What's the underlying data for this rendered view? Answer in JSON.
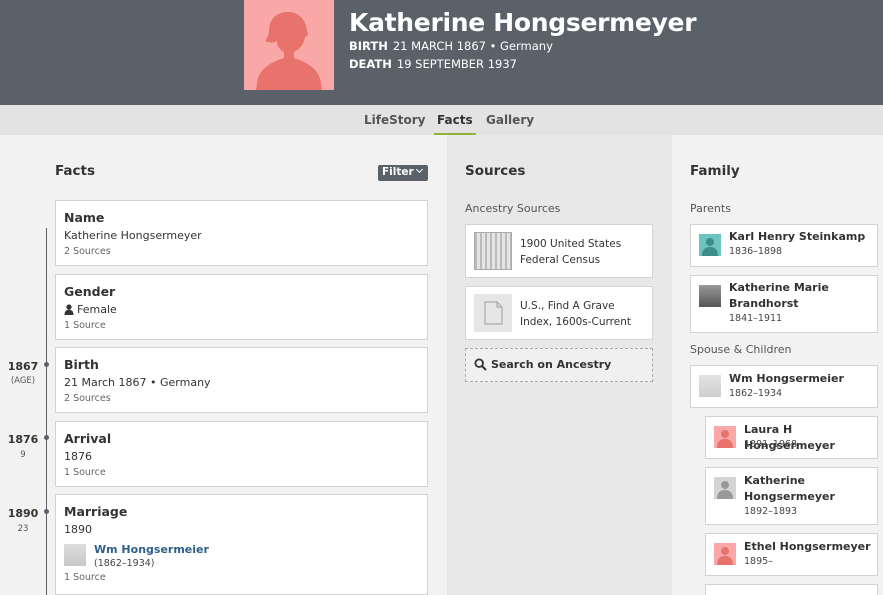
{
  "profile": {
    "name": "Katherine Hongsermeyer",
    "birth_label": "BIRTH",
    "birth_value": "21 MARCH 1867 • Germany",
    "death_label": "DEATH",
    "death_value": "19 SEPTEMBER 1937",
    "portrait_color": "#f9a7a7"
  },
  "tabs": [
    {
      "label": "LifeStory",
      "active": false
    },
    {
      "label": "Facts",
      "active": true
    },
    {
      "label": "Gallery",
      "active": false
    }
  ],
  "facts": {
    "title": "Facts",
    "filter_label": "Filter",
    "items": [
      {
        "title": "Name",
        "value": "Katherine Hongsermeyer",
        "sources": "2 Sources"
      },
      {
        "title": "Gender",
        "value": "Female",
        "sources": "1 Source",
        "icon": "person-icon"
      },
      {
        "title": "Birth",
        "value": "21 March 1867 • Germany",
        "sources": "2 Sources",
        "year": "1867",
        "age": "(AGE)"
      },
      {
        "title": "Arrival",
        "value": "1876",
        "sources": "1 Source",
        "year": "1876",
        "age": "9"
      },
      {
        "title": "Marriage",
        "value": "1890",
        "sources": "1 Source",
        "year": "1890",
        "age": "23",
        "spouse_name": "Wm Hongsermeier",
        "spouse_years": "(1862–1934)"
      }
    ]
  },
  "sources": {
    "title": "Sources",
    "subtitle": "Ancestry Sources",
    "items": [
      {
        "label": "1900 United States Federal Census",
        "icon": "census-thumbnail"
      },
      {
        "label": "U.S., Find A Grave Index, 1600s-Current",
        "icon": "document-icon"
      }
    ],
    "search_label": "Search on Ancestry"
  },
  "family": {
    "title": "Family",
    "parents_label": "Parents",
    "parents": [
      {
        "name": "Karl Henry Steinkamp",
        "years": "1836–1898",
        "avatar": "male-avatar-teal"
      },
      {
        "name": "Katherine Marie Brandhorst",
        "years": "1841–1911",
        "avatar": "photo-thumbnail"
      }
    ],
    "spouse_label": "Spouse & Children",
    "spouse": {
      "name": "Wm Hongsermeier",
      "years": "1862–1934",
      "avatar": "photo-thumbnail"
    },
    "children": [
      {
        "name": "Laura H Hongsermeyer",
        "years": "1891–1968",
        "avatar": "female-avatar-pink"
      },
      {
        "name": "Katherine Hongsermeyer",
        "years": "1892–1893",
        "avatar": "unknown-avatar-gray"
      },
      {
        "name": "Ethel Hongsermeyer",
        "years": "1895–",
        "avatar": "female-avatar-pink"
      }
    ]
  },
  "colors": {
    "header_bg": "#5a6169",
    "active_tab_underline": "#8cb33c",
    "link": "#2f5f8a",
    "female_avatar": "#f9a7a7",
    "male_avatar": "#6cc4c0"
  }
}
